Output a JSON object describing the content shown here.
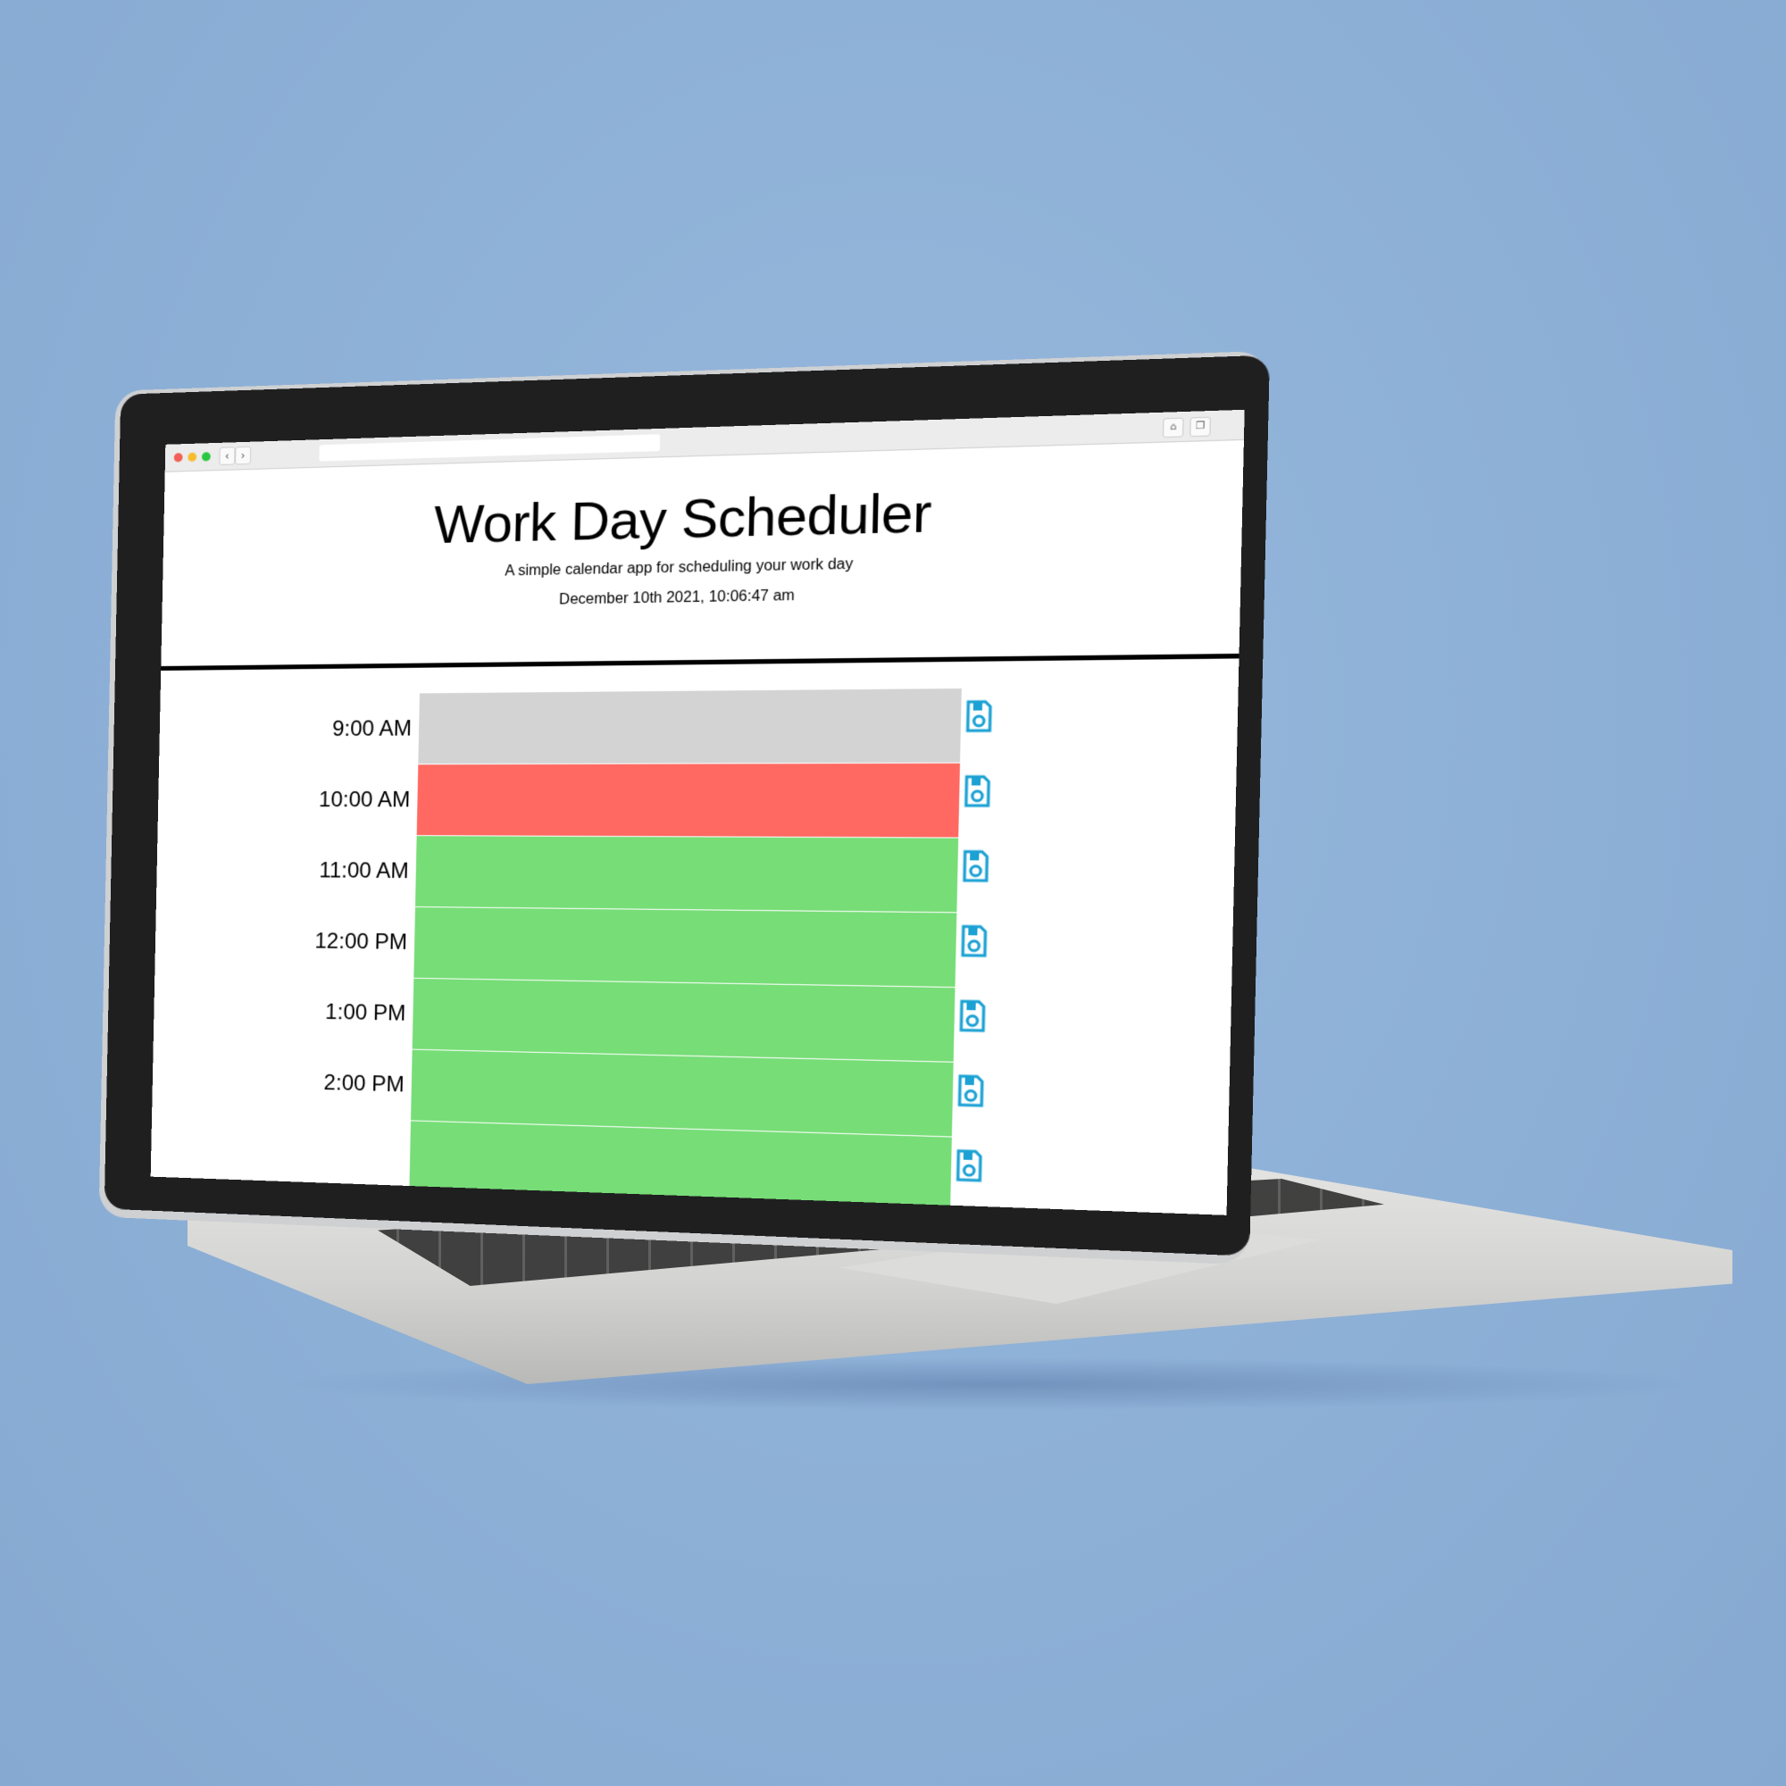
{
  "app": {
    "title": "Work Day Scheduler",
    "lead": "A simple calendar app for scheduling your work day",
    "current_day": "December 10th 2021, 10:06:47 am"
  },
  "browser": {
    "back_label": "‹",
    "forward_label": "›",
    "home_icon": "home-icon",
    "tabs_icon": "tabs-icon"
  },
  "colors": {
    "past": "#d3d3d3",
    "present": "#ff6961",
    "future": "#77dd77",
    "save_icon": "#1ba1d4",
    "background": "#8fb1d7"
  },
  "timeblocks": [
    {
      "hour": "9:00 AM",
      "status": "past",
      "text": ""
    },
    {
      "hour": "10:00 AM",
      "status": "present",
      "text": ""
    },
    {
      "hour": "11:00 AM",
      "status": "future",
      "text": ""
    },
    {
      "hour": "12:00 PM",
      "status": "future",
      "text": ""
    },
    {
      "hour": "1:00 PM",
      "status": "future",
      "text": ""
    },
    {
      "hour": "2:00 PM",
      "status": "future",
      "text": ""
    },
    {
      "hour": "",
      "status": "future",
      "text": ""
    }
  ],
  "icons": {
    "save": "floppy-disk-icon"
  }
}
